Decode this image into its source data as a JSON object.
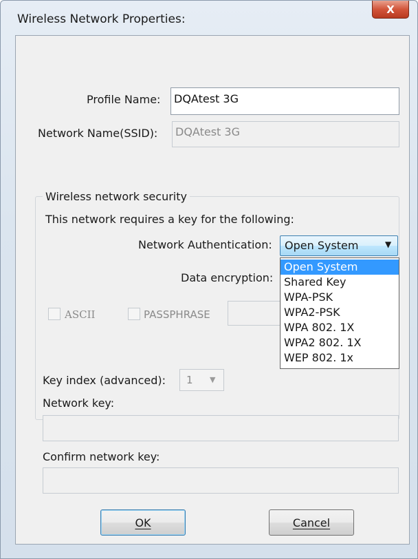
{
  "window": {
    "title": "Wireless Network Properties:"
  },
  "profile": {
    "label": "Profile Name:",
    "value": "DQAtest  3G"
  },
  "ssid": {
    "label": "Network Name(SSID):",
    "value": "DQAtest  3G"
  },
  "security": {
    "group_title": "Wireless network security",
    "requires_text": "This network requires a key for the following:",
    "auth_label": "Network Authentication:",
    "auth_selected": "Open System",
    "auth_options": [
      "Open System",
      "Shared Key",
      "WPA-PSK",
      "WPA2-PSK",
      "WPA 802. 1X",
      "WPA2 802. 1X",
      "WEP 802. 1x"
    ],
    "encryption_label": "Data encryption:",
    "ascii_label": "ASCII",
    "passphrase_label": "PASSPHRASE"
  },
  "key": {
    "index_label": "Key index (advanced):",
    "index_value": "1",
    "network_key_label": "Network key:",
    "confirm_label": "Confirm network key:"
  },
  "buttons": {
    "ok": "OK",
    "cancel": "Cancel"
  },
  "icons": {
    "close": "close-icon",
    "dropdown": "chevron-down-icon"
  }
}
